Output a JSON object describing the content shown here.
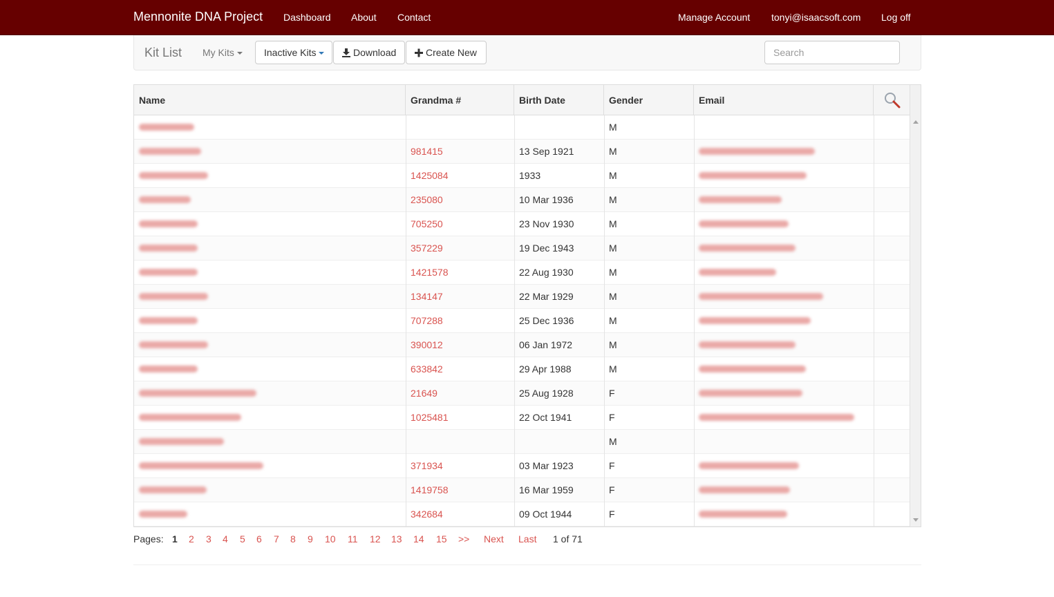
{
  "navbar": {
    "brand": "Mennonite DNA Project",
    "left_links": [
      "Dashboard",
      "About",
      "Contact"
    ],
    "right_links": [
      "Manage Account",
      "tonyi@isaacsoft.com",
      "Log off"
    ],
    "bg_color": "#660000"
  },
  "toolbar": {
    "title": "Kit List",
    "my_kits": "My Kits",
    "inactive_kits": "Inactive Kits",
    "download": "Download",
    "create_new": "Create New",
    "search_placeholder": "Search"
  },
  "table": {
    "columns": [
      "Name",
      "Grandma #",
      "Birth Date",
      "Gender",
      "Email"
    ],
    "rows": [
      {
        "grandma": "",
        "birth": "",
        "gender": "M"
      },
      {
        "grandma": "981415",
        "birth": "13 Sep 1921",
        "gender": "M"
      },
      {
        "grandma": "1425084",
        "birth": "1933",
        "gender": "M"
      },
      {
        "grandma": "235080",
        "birth": "10 Mar 1936",
        "gender": "M"
      },
      {
        "grandma": "705250",
        "birth": "23 Nov 1930",
        "gender": "M"
      },
      {
        "grandma": "357229",
        "birth": "19 Dec 1943",
        "gender": "M"
      },
      {
        "grandma": "1421578",
        "birth": "22 Aug 1930",
        "gender": "M"
      },
      {
        "grandma": "134147",
        "birth": "22 Mar 1929",
        "gender": "M"
      },
      {
        "grandma": "707288",
        "birth": "25 Dec 1936",
        "gender": "M"
      },
      {
        "grandma": "390012",
        "birth": "06 Jan 1972",
        "gender": "M"
      },
      {
        "grandma": "633842",
        "birth": "29 Apr 1988",
        "gender": "M"
      },
      {
        "grandma": "21649",
        "birth": "25 Aug 1928",
        "gender": "F"
      },
      {
        "grandma": "1025481",
        "birth": "22 Oct 1941",
        "gender": "F"
      },
      {
        "grandma": "",
        "birth": "",
        "gender": "M"
      },
      {
        "grandma": "371934",
        "birth": "03 Mar 1923",
        "gender": "F"
      },
      {
        "grandma": "1419758",
        "birth": "16 Mar 1959",
        "gender": "F"
      },
      {
        "grandma": "342684",
        "birth": "09 Oct 1944",
        "gender": "F"
      }
    ]
  },
  "pagination": {
    "label": "Pages:",
    "current": "1",
    "pages": [
      "2",
      "3",
      "4",
      "5",
      "6",
      "7",
      "8",
      "9",
      "10",
      "11",
      "12",
      "13",
      "14",
      "15"
    ],
    "more": ">>",
    "next": "Next",
    "last": "Last",
    "info": "1 of 71"
  },
  "colors": {
    "link": "#d9534f",
    "header_bg": "#f5f5f5"
  }
}
